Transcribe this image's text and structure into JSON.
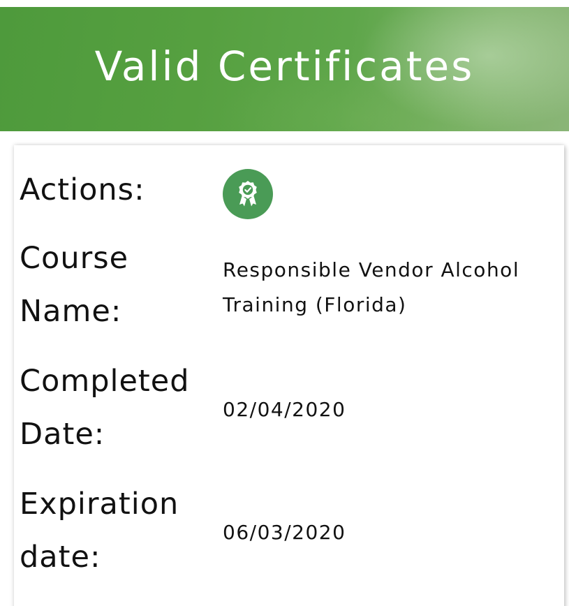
{
  "header": {
    "title": "Valid Certificates"
  },
  "certificate": {
    "actions_label": "Actions:",
    "action_icon": "certificate-award-icon",
    "course_label_line1": "Course",
    "course_label_line2": "Name:",
    "course_name_line1": "Responsible Vendor Alcohol",
    "course_name_line2": "Training (Florida)",
    "completed_label_line1": "Completed",
    "completed_label_line2": "Date:",
    "completed_date": "02/04/2020",
    "expiration_label_line1": "Expiration",
    "expiration_label_line2": "date:",
    "expiration_date": "06/03/2020"
  },
  "colors": {
    "banner_green": "#56a040",
    "action_button_green": "#4a9b56"
  }
}
